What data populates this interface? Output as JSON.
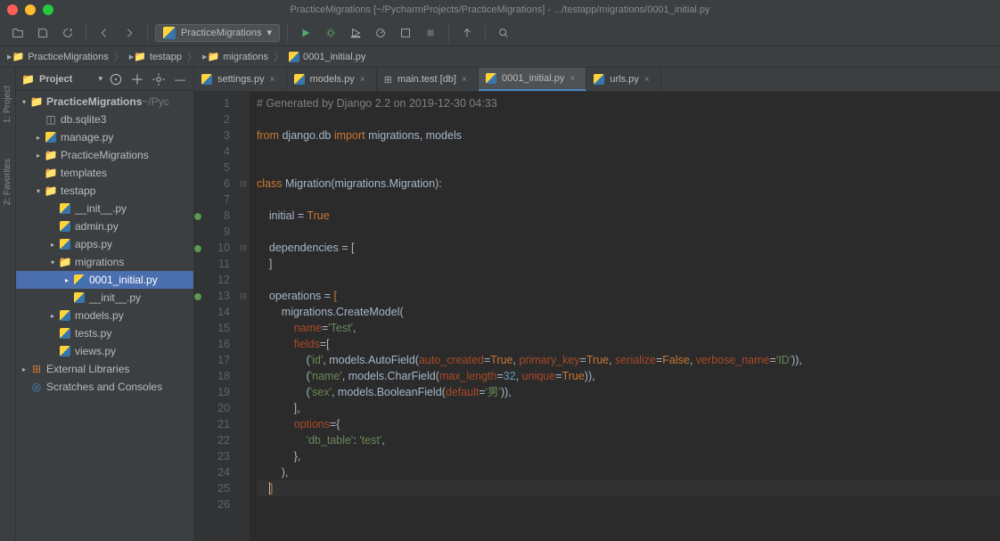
{
  "window": {
    "title": "PracticeMigrations [~/PycharmProjects/PracticeMigrations] - .../testapp/migrations/0001_initial.py"
  },
  "run_config": {
    "name": "PracticeMigrations"
  },
  "breadcrumb": [
    {
      "label": "PracticeMigrations",
      "icon": "folder"
    },
    {
      "label": "testapp",
      "icon": "folder"
    },
    {
      "label": "migrations",
      "icon": "folder"
    },
    {
      "label": "0001_initial.py",
      "icon": "python"
    }
  ],
  "panel": {
    "title": "Project"
  },
  "left_rail": [
    "1: Project",
    "2: Favorites"
  ],
  "tree": [
    {
      "label": "PracticeMigrations",
      "suffix": "~/Pyc",
      "icon": "folder-open",
      "indent": 0,
      "arrow": "down",
      "bold": true
    },
    {
      "label": "db.sqlite3",
      "icon": "db",
      "indent": 1,
      "arrow": ""
    },
    {
      "label": "manage.py",
      "icon": "python",
      "indent": 1,
      "arrow": "right"
    },
    {
      "label": "PracticeMigrations",
      "icon": "folder",
      "indent": 1,
      "arrow": "right"
    },
    {
      "label": "templates",
      "icon": "folder-purple",
      "indent": 1,
      "arrow": ""
    },
    {
      "label": "testapp",
      "icon": "folder",
      "indent": 1,
      "arrow": "down"
    },
    {
      "label": "__init__.py",
      "icon": "python",
      "indent": 2,
      "arrow": ""
    },
    {
      "label": "admin.py",
      "icon": "python",
      "indent": 2,
      "arrow": ""
    },
    {
      "label": "apps.py",
      "icon": "python",
      "indent": 2,
      "arrow": "right"
    },
    {
      "label": "migrations",
      "icon": "folder",
      "indent": 2,
      "arrow": "down"
    },
    {
      "label": "0001_initial.py",
      "icon": "python",
      "indent": 3,
      "arrow": "right",
      "selected": true
    },
    {
      "label": "__init__.py",
      "icon": "python",
      "indent": 3,
      "arrow": ""
    },
    {
      "label": "models.py",
      "icon": "python",
      "indent": 2,
      "arrow": "right"
    },
    {
      "label": "tests.py",
      "icon": "python",
      "indent": 2,
      "arrow": ""
    },
    {
      "label": "views.py",
      "icon": "python",
      "indent": 2,
      "arrow": ""
    },
    {
      "label": "External Libraries",
      "icon": "lib",
      "indent": 0,
      "arrow": "right"
    },
    {
      "label": "Scratches and Consoles",
      "icon": "scratch",
      "indent": 0,
      "arrow": ""
    }
  ],
  "tabs": [
    {
      "label": "settings.py",
      "icon": "python",
      "active": false
    },
    {
      "label": "models.py",
      "icon": "python",
      "active": false
    },
    {
      "label": "main.test [db]",
      "icon": "table",
      "active": false
    },
    {
      "label": "0001_initial.py",
      "icon": "python",
      "active": true
    },
    {
      "label": "urls.py",
      "icon": "python",
      "active": false
    }
  ],
  "code": {
    "lines": [
      {
        "n": 1,
        "html": "<span class='c-comment'># Generated by Django 2.2 on 2019-12-30 04:33</span>"
      },
      {
        "n": 2,
        "html": ""
      },
      {
        "n": 3,
        "html": "<span class='c-keyword'>from</span> django.db <span class='c-keyword'>import</span> migrations<span class='c-paren'>,</span> models"
      },
      {
        "n": 4,
        "html": ""
      },
      {
        "n": 5,
        "html": ""
      },
      {
        "n": 6,
        "html": "<span class='c-keyword'>class</span> Migration(migrations.Migration):",
        "fold": "-"
      },
      {
        "n": 7,
        "html": ""
      },
      {
        "n": 8,
        "html": "    initial = <span class='c-bool'>True</span>",
        "marker": true
      },
      {
        "n": 9,
        "html": ""
      },
      {
        "n": 10,
        "html": "    dependencies = [",
        "marker": true,
        "fold": "-"
      },
      {
        "n": 11,
        "html": "    ]"
      },
      {
        "n": 12,
        "html": ""
      },
      {
        "n": 13,
        "html": "    operations = <span class='c-keyword'>[</span>",
        "marker": true,
        "fold": "-"
      },
      {
        "n": 14,
        "html": "        migrations.CreateModel("
      },
      {
        "n": 15,
        "html": "            <span class='c-param'>name</span>=<span class='c-string'>'Test'</span><span class='c-paren'>,</span>"
      },
      {
        "n": 16,
        "html": "            <span class='c-param'>fields</span>=["
      },
      {
        "n": 17,
        "html": "                (<span class='c-string'>'id'</span><span class='c-paren'>,</span> models.AutoField(<span class='c-param'>auto_created</span>=<span class='c-bool'>True</span><span class='c-paren'>,</span> <span class='c-param'>primary_key</span>=<span class='c-bool'>True</span><span class='c-paren'>,</span> <span class='c-param'>serialize</span>=<span class='c-bool'>False</span><span class='c-paren'>,</span> <span class='c-param'>verbose_name</span>=<span class='c-string'>'ID'</span>))<span class='c-paren'>,</span>"
      },
      {
        "n": 18,
        "html": "                (<span class='c-string'>'name'</span><span class='c-paren'>,</span> models.CharField(<span class='c-param'>max_length</span>=<span class='c-number'>32</span><span class='c-paren'>,</span> <span class='c-param'>unique</span>=<span class='c-bool'>True</span>))<span class='c-paren'>,</span>"
      },
      {
        "n": 19,
        "html": "                (<span class='c-string'>'sex'</span><span class='c-paren'>,</span> models.BooleanField(<span class='c-param'>default</span>=<span class='c-string'>'男'</span>))<span class='c-paren'>,</span>"
      },
      {
        "n": 20,
        "html": "            ]<span class='c-paren'>,</span>"
      },
      {
        "n": 21,
        "html": "            <span class='c-param'>options</span>={"
      },
      {
        "n": 22,
        "html": "                <span class='c-string'>'db_table'</span>: <span class='c-string'>'test'</span><span class='c-paren'>,</span>"
      },
      {
        "n": 23,
        "html": "            }<span class='c-paren'>,</span>"
      },
      {
        "n": 24,
        "html": "        )<span class='c-paren'>,</span>"
      },
      {
        "n": 25,
        "html": "    <span class='c-keyword caret'>]</span>",
        "current": true
      },
      {
        "n": 26,
        "html": ""
      }
    ]
  }
}
